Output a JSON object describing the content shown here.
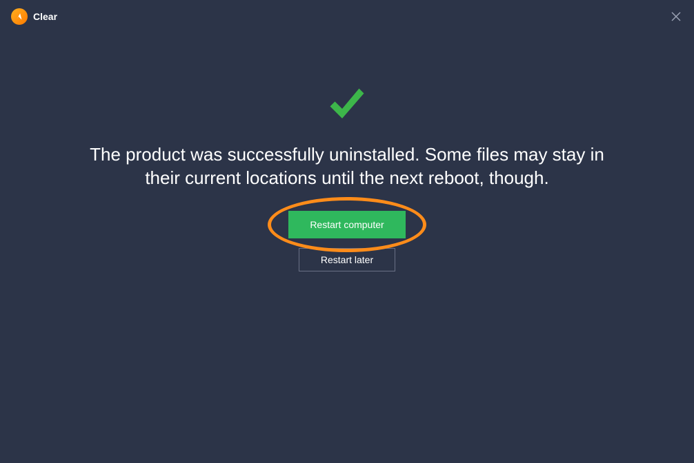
{
  "header": {
    "title": "Clear",
    "logoIcon": "avast-logo",
    "closeIcon": "close"
  },
  "content": {
    "checkmarkIcon": "checkmark-success",
    "message": "The product was successfully uninstalled. Some files may stay in their current locations until the next reboot, though.",
    "restartButtonLabel": "Restart computer",
    "laterButtonLabel": "Restart later"
  },
  "colors": {
    "background": "#2c3448",
    "accent": "#2fb85d",
    "highlight": "#ff8c1a",
    "logo": "#ff8c00"
  }
}
